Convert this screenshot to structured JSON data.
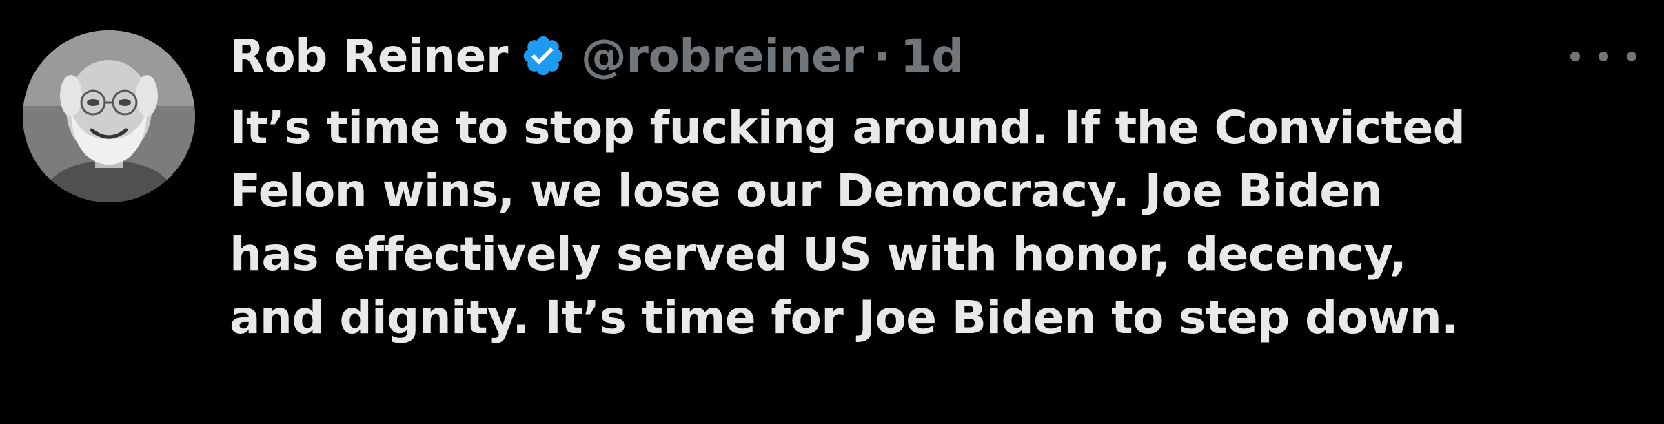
{
  "tweet": {
    "author": {
      "display_name": "Rob Reiner",
      "handle": "@robreiner",
      "verified": true,
      "avatar": "profile-photo"
    },
    "separator": "·",
    "timestamp": "1d",
    "more_icon": "more-options-icon",
    "text_lines": [
      "It’s time to stop fucking around. If the Convicted",
      "Felon wins, we lose our Democracy. Joe Biden",
      "has effectively served US with honor, decency,",
      "and dignity. It’s time for Joe Biden to step down."
    ]
  },
  "colors": {
    "background": "#000000",
    "text_primary": "#e7e9ea",
    "text_secondary": "#71767b",
    "verified_badge": "#1d9bf0"
  }
}
